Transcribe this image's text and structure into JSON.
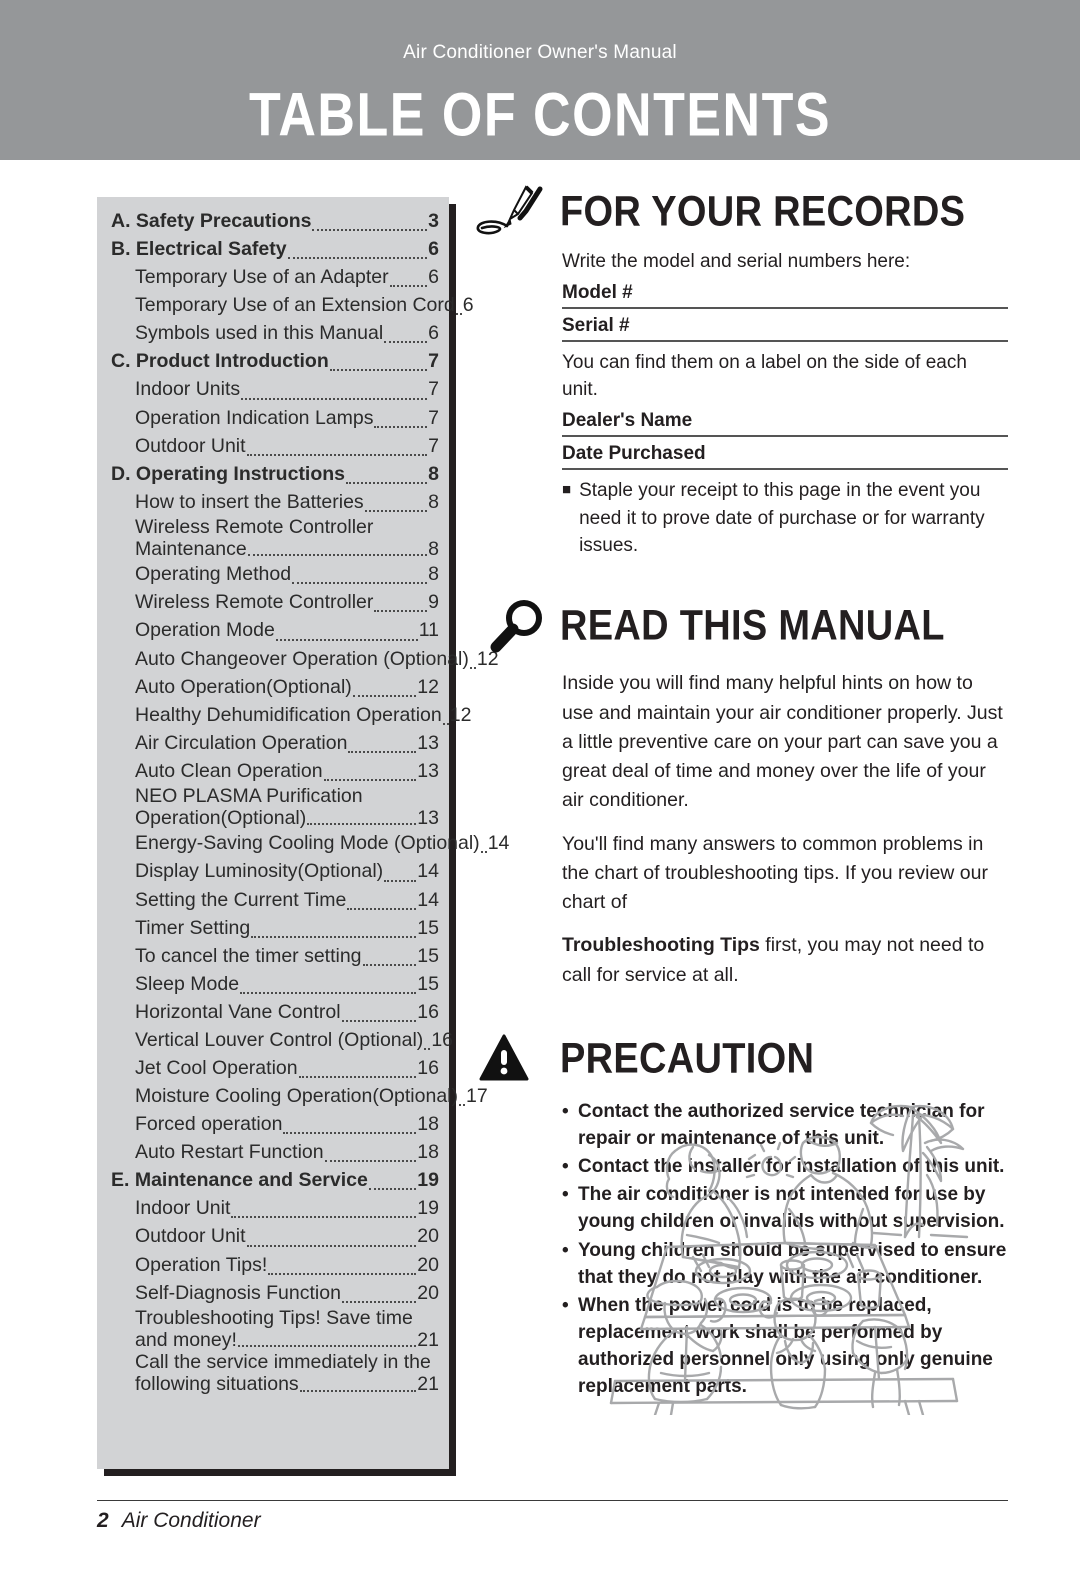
{
  "header": {
    "subtitle": "Air Conditioner Owner's Manual",
    "title": "TABLE OF CONTENTS",
    "bg_color": "#959799"
  },
  "toc": {
    "box_color": "#d2d3d5",
    "entries": [
      {
        "level": 1,
        "label": "A. Safety Precautions",
        "page": "3"
      },
      {
        "level": 1,
        "label": "B. Electrical Safety",
        "page": "6"
      },
      {
        "level": 2,
        "label": "Temporary Use of an Adapter",
        "page": "6"
      },
      {
        "level": 2,
        "label": "Temporary Use of an Extension Cord",
        "page": "6"
      },
      {
        "level": 2,
        "label": "Symbols used in this Manual",
        "page": "6"
      },
      {
        "level": 1,
        "label": "C. Product Introduction",
        "page": "7"
      },
      {
        "level": 2,
        "label": "Indoor Units",
        "page": "7"
      },
      {
        "level": 2,
        "label": "Operation Indication Lamps",
        "page": "7"
      },
      {
        "level": 2,
        "label": "Outdoor Unit",
        "page": "7"
      },
      {
        "level": 1,
        "label": "D. Operating Instructions",
        "page": "8"
      },
      {
        "level": 2,
        "label": "How to insert the Batteries",
        "page": "8"
      },
      {
        "level": 2,
        "label": "Wireless Remote Controller",
        "label2": "Maintenance",
        "page": "8"
      },
      {
        "level": 2,
        "label": "Operating Method",
        "page": "8"
      },
      {
        "level": 2,
        "label": "Wireless Remote Controller",
        "page": "9"
      },
      {
        "level": 2,
        "label": "Operation Mode",
        "page": "11"
      },
      {
        "level": 2,
        "label": "Auto Changeover Operation (Optional)",
        "page": "12"
      },
      {
        "level": 2,
        "label": "Auto Operation(Optional)",
        "page": "12"
      },
      {
        "level": 2,
        "label": "Healthy Dehumidification Operation",
        "page": "12"
      },
      {
        "level": 2,
        "label": "Air Circulation Operation",
        "page": "13"
      },
      {
        "level": 2,
        "label": "Auto Clean Operation",
        "page": "13"
      },
      {
        "level": 2,
        "label": "NEO PLASMA Purification",
        "label2": "Operation(Optional)",
        "page": "13"
      },
      {
        "level": 2,
        "label": "Energy-Saving Cooling Mode (Optional)",
        "page": "14"
      },
      {
        "level": 2,
        "label": "Display Luminosity(Optional)",
        "page": "14"
      },
      {
        "level": 2,
        "label": "Setting the Current Time",
        "page": "14"
      },
      {
        "level": 2,
        "label": "Timer Setting",
        "page": "15"
      },
      {
        "level": 2,
        "label": "To cancel the timer setting",
        "page": "15"
      },
      {
        "level": 2,
        "label": "Sleep Mode",
        "page": "15"
      },
      {
        "level": 2,
        "label": "Horizontal Vane Control",
        "page": "16"
      },
      {
        "level": 2,
        "label": "Vertical Louver Control (Optional)",
        "page": "16"
      },
      {
        "level": 2,
        "label": "Jet Cool Operation",
        "page": "16"
      },
      {
        "level": 2,
        "label": "Moisture Cooling Operation(Optional)",
        "page": "17"
      },
      {
        "level": 2,
        "label": "Forced operation",
        "page": "18"
      },
      {
        "level": 2,
        "label": "Auto Restart Function",
        "page": "18"
      },
      {
        "level": 1,
        "label": "E. Maintenance and Service",
        "page": "19"
      },
      {
        "level": 2,
        "label": "Indoor Unit",
        "page": "19"
      },
      {
        "level": 2,
        "label": "Outdoor Unit",
        "page": "20"
      },
      {
        "level": 2,
        "label": "Operation Tips!",
        "page": "20"
      },
      {
        "level": 2,
        "label": "Self-Diagnosis Function",
        "page": "20"
      },
      {
        "level": 2,
        "label": "Troubleshooting Tips! Save time",
        "label2": "and money!",
        "page": "21"
      },
      {
        "level": 2,
        "label": "Call the service immediately in the",
        "label2": "following situations",
        "page": "21"
      }
    ]
  },
  "records": {
    "icon": "pen-icon",
    "title": "FOR YOUR RECORDS",
    "intro": "Write the model and serial numbers here:",
    "field_model": "Model #",
    "field_serial": "Serial #",
    "find_note": "You can find them on a label on the side of each unit.",
    "field_dealer": "Dealer's Name",
    "field_date": "Date Purchased",
    "bullet_square": "■",
    "staple_note": "Staple your receipt to this page in the event you need it to prove date of purchase or for warranty issues."
  },
  "read_manual": {
    "icon": "magnifier-icon",
    "title": "READ THIS MANUAL",
    "para1": "Inside you will find many helpful hints on how to use and maintain your air conditioner properly. Just a little preventive care on your part can save you a great deal of time and money over the life of your air conditioner.",
    "para2": "You'll find many answers to common problems in the chart of troubleshooting tips. If you review our chart of",
    "para3_bold": "Troubleshooting Tips",
    "para3_rest": " first, you may not need to call for service at all."
  },
  "precaution": {
    "icon": "warning-triangle-icon",
    "title": "PRECAUTION",
    "items": [
      "Contact the authorized service technician for repair or maintenance of this unit.",
      "Contact the installer for installation of this unit.",
      "The air conditioner is not intended for use by young children or invalids without supervision.",
      "Young children should be supervised to ensure that they do not play with the air conditioner.",
      "When the power cord is to be replaced, replacement work shall be performed by authorized personnel only using only genuine replacement parts."
    ]
  },
  "illustration": {
    "name": "family-picnic-table-illustration",
    "stroke_color": "#a8a9ab"
  },
  "footer": {
    "page_number": "2",
    "label": "Air Conditioner"
  }
}
